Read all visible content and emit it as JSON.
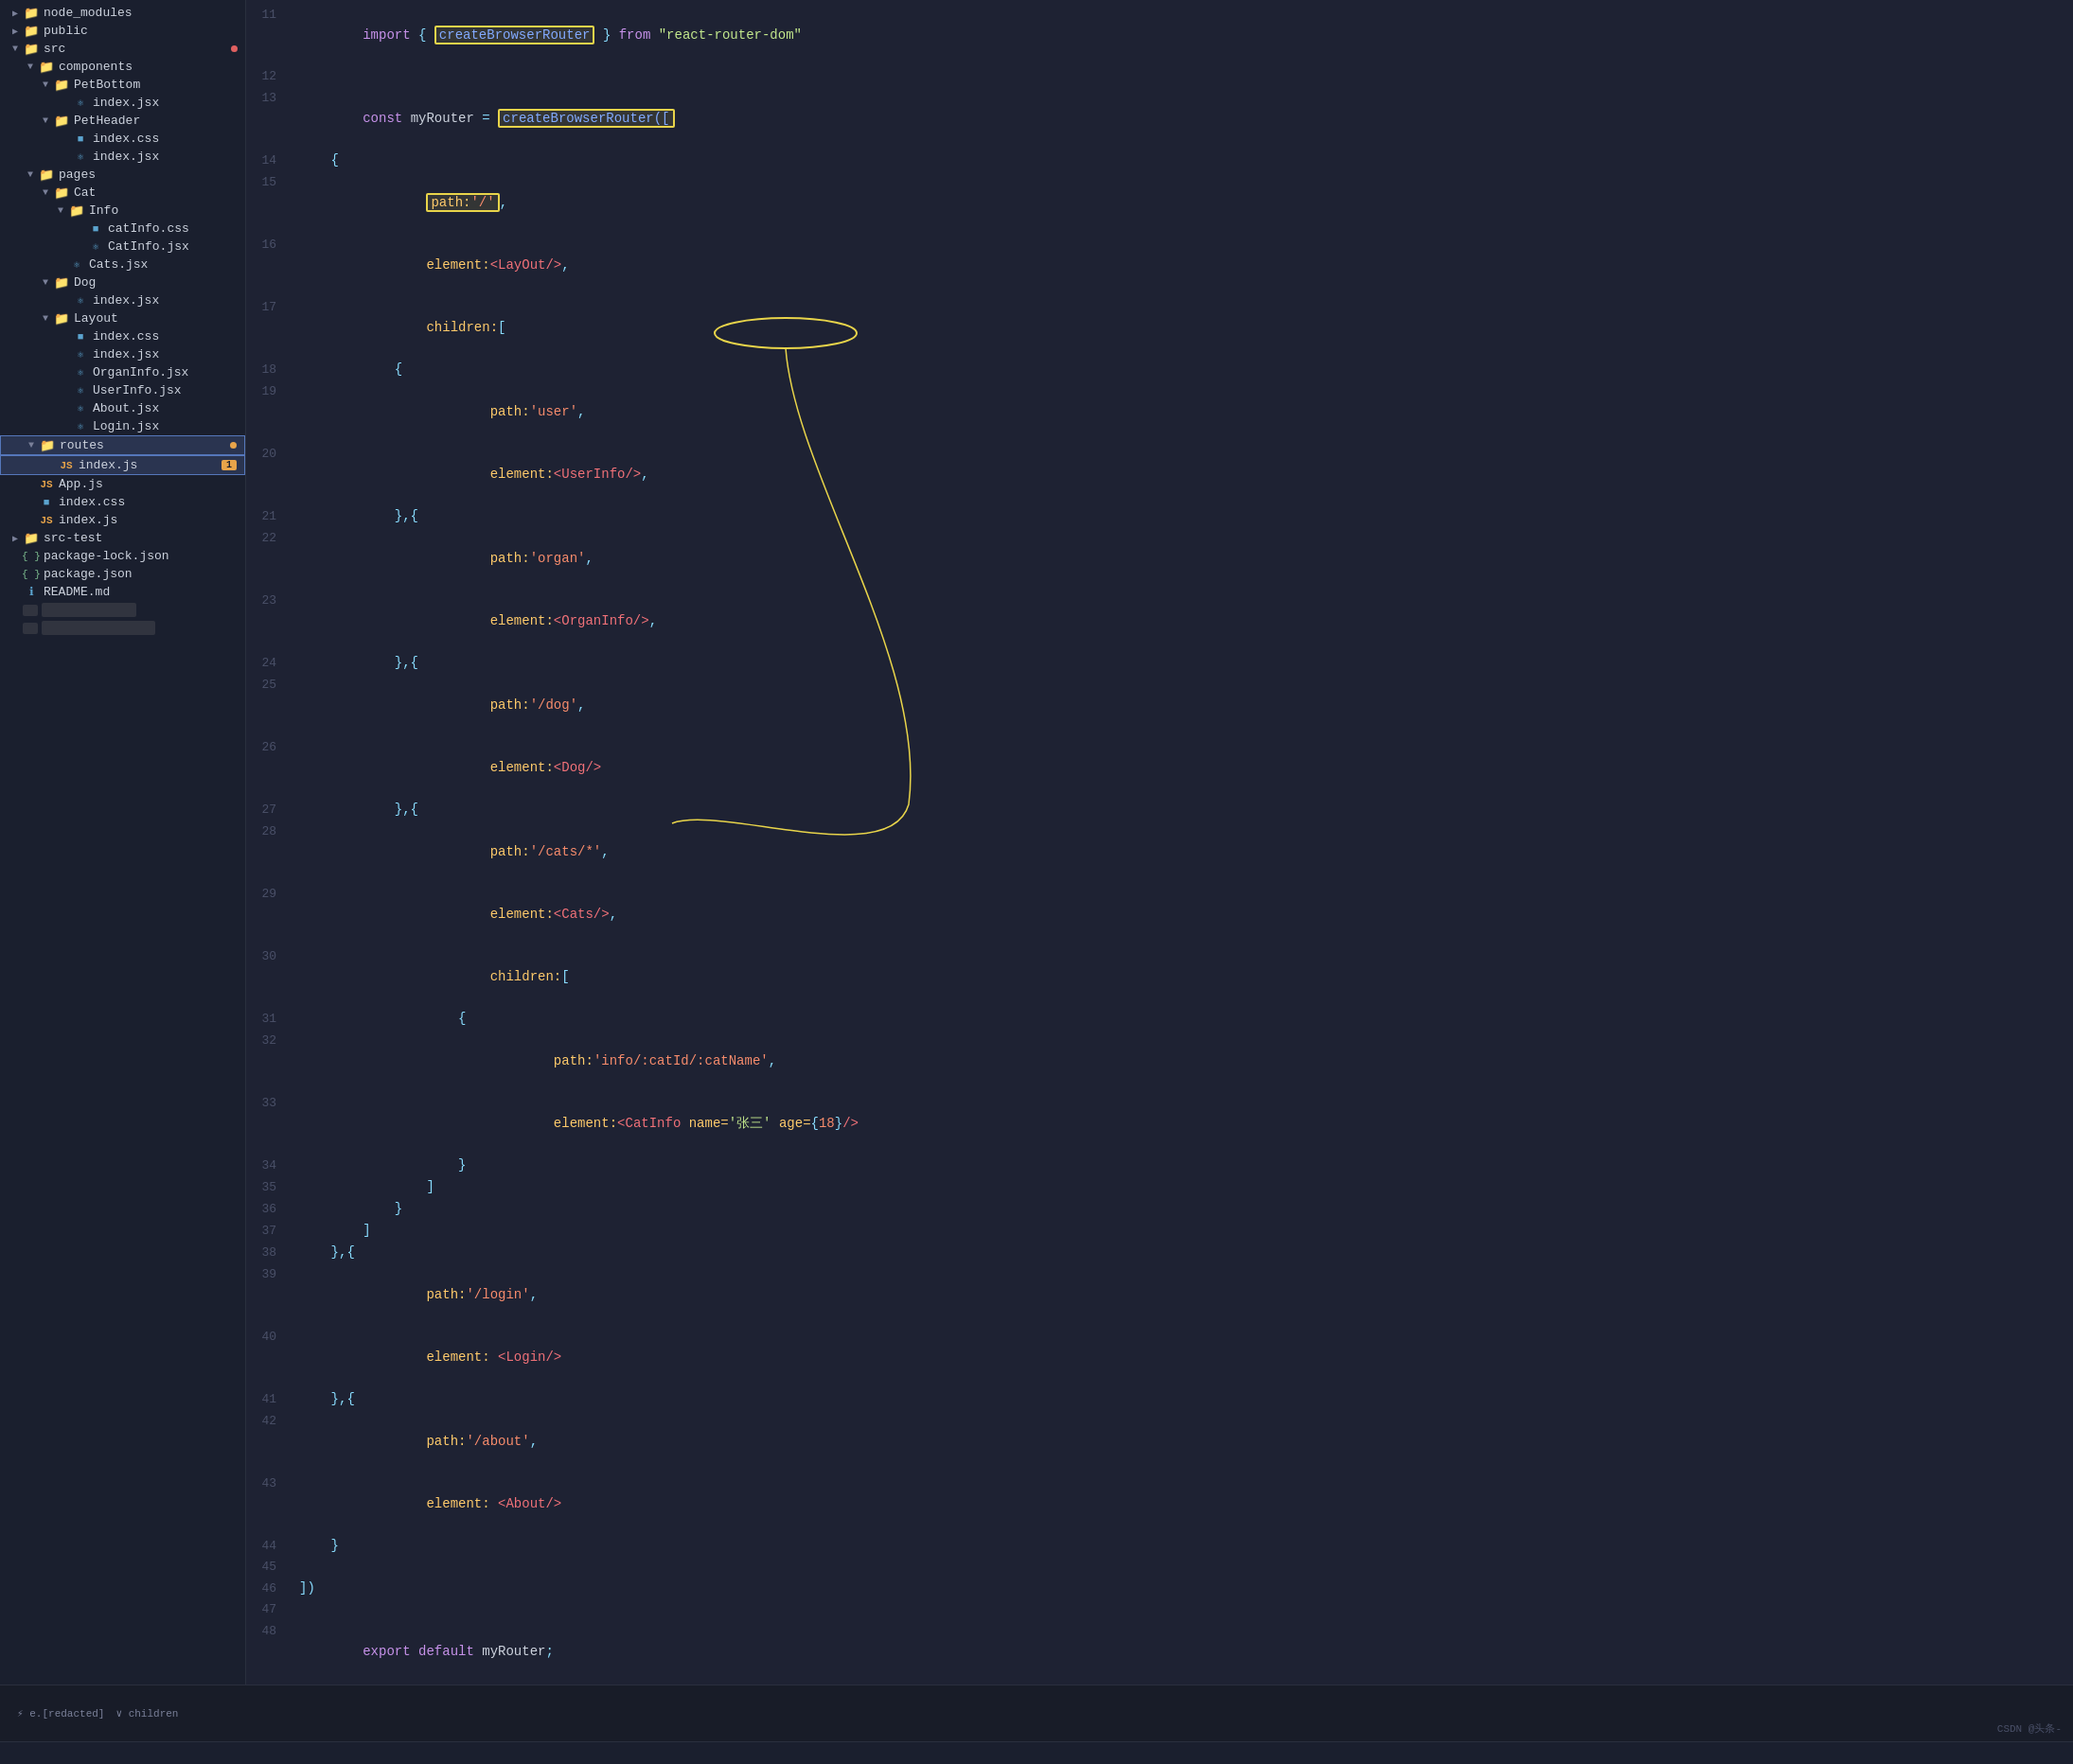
{
  "sidebar": {
    "items": [
      {
        "id": "node_modules",
        "label": "node_modules",
        "type": "folder",
        "indent": 0,
        "collapsed": true,
        "hasDot": false
      },
      {
        "id": "public",
        "label": "public",
        "type": "folder",
        "indent": 0,
        "collapsed": true,
        "hasDot": false
      },
      {
        "id": "src",
        "label": "src",
        "type": "folder",
        "indent": 0,
        "collapsed": false,
        "hasDot": true
      },
      {
        "id": "components",
        "label": "components",
        "type": "folder",
        "indent": 1,
        "collapsed": false
      },
      {
        "id": "PetBottom",
        "label": "PetBottom",
        "type": "folder",
        "indent": 2,
        "collapsed": false
      },
      {
        "id": "PetBottom_index",
        "label": "index.jsx",
        "type": "jsx",
        "indent": 3
      },
      {
        "id": "PetHeader",
        "label": "PetHeader",
        "type": "folder",
        "indent": 2,
        "collapsed": false
      },
      {
        "id": "PetHeader_css",
        "label": "index.css",
        "type": "css",
        "indent": 3
      },
      {
        "id": "PetHeader_jsx",
        "label": "index.jsx",
        "type": "jsx",
        "indent": 3
      },
      {
        "id": "pages",
        "label": "pages",
        "type": "folder",
        "indent": 1,
        "collapsed": false
      },
      {
        "id": "Cat",
        "label": "Cat",
        "type": "folder-orange",
        "indent": 2,
        "collapsed": false
      },
      {
        "id": "Info",
        "label": "Info",
        "type": "folder-orange",
        "indent": 3,
        "collapsed": false
      },
      {
        "id": "catInfo_css",
        "label": "catInfo.css",
        "type": "css",
        "indent": 4
      },
      {
        "id": "CatInfo_jsx",
        "label": "CatInfo.jsx",
        "type": "jsx",
        "indent": 4
      },
      {
        "id": "Cats_jsx",
        "label": "Cats.jsx",
        "type": "jsx",
        "indent": 3
      },
      {
        "id": "Dog",
        "label": "Dog",
        "type": "folder",
        "indent": 2,
        "collapsed": false
      },
      {
        "id": "Dog_index",
        "label": "index.jsx",
        "type": "jsx",
        "indent": 3
      },
      {
        "id": "Layout",
        "label": "Layout",
        "type": "folder",
        "indent": 2,
        "collapsed": false
      },
      {
        "id": "Layout_css",
        "label": "index.css",
        "type": "css",
        "indent": 3
      },
      {
        "id": "Layout_jsx",
        "label": "index.jsx",
        "type": "jsx",
        "indent": 3
      },
      {
        "id": "OrganInfo_jsx",
        "label": "OrganInfo.jsx",
        "type": "jsx",
        "indent": 3
      },
      {
        "id": "UserInfo_jsx",
        "label": "UserInfo.jsx",
        "type": "jsx",
        "indent": 3
      },
      {
        "id": "About_jsx",
        "label": "About.jsx",
        "type": "jsx",
        "indent": 3
      },
      {
        "id": "Login_jsx",
        "label": "Login.jsx",
        "type": "jsx",
        "indent": 3
      },
      {
        "id": "routes",
        "label": "routes",
        "type": "folder-highlighted",
        "indent": 1,
        "collapsed": false,
        "hasDot": true
      },
      {
        "id": "routes_index",
        "label": "index.js",
        "type": "js-highlighted",
        "indent": 2,
        "badge": "1"
      },
      {
        "id": "App_js",
        "label": "App.js",
        "type": "js",
        "indent": 1
      },
      {
        "id": "index_css",
        "label": "index.css",
        "type": "css",
        "indent": 1
      },
      {
        "id": "index_js2",
        "label": "index.js",
        "type": "js",
        "indent": 1
      },
      {
        "id": "src-test",
        "label": "src-test",
        "type": "folder",
        "indent": 0,
        "collapsed": true
      },
      {
        "id": "package_lock",
        "label": "package-lock.json",
        "type": "json",
        "indent": 0
      },
      {
        "id": "package_json",
        "label": "package.json",
        "type": "json",
        "indent": 0
      },
      {
        "id": "README",
        "label": "README.md",
        "type": "md-info",
        "indent": 0
      }
    ]
  },
  "editor": {
    "filename": "index.js",
    "lines": [
      {
        "num": 11,
        "tokens": [
          {
            "text": "import ",
            "cls": "kw"
          },
          {
            "text": "{ ",
            "cls": "punct"
          },
          {
            "text": "createBrowserRouter",
            "cls": "fn",
            "highlight": "box-yellow"
          },
          {
            "text": " }",
            "cls": "punct"
          },
          {
            "text": " from ",
            "cls": "kw"
          },
          {
            "text": "\"react-router-dom\"",
            "cls": "str"
          }
        ]
      },
      {
        "num": 12,
        "tokens": []
      },
      {
        "num": 13,
        "tokens": [
          {
            "text": "const ",
            "cls": "kw"
          },
          {
            "text": "myRouter ",
            "cls": "plain"
          },
          {
            "text": "= ",
            "cls": "punct"
          },
          {
            "text": "createBrowserRouter([",
            "cls": "fn",
            "highlight": "box-yellow"
          }
        ]
      },
      {
        "num": 14,
        "tokens": [
          {
            "text": "    {",
            "cls": "punct"
          }
        ]
      },
      {
        "num": 15,
        "tokens": [
          {
            "text": "        ",
            "cls": "plain"
          },
          {
            "text": "path:'/'",
            "cls": "",
            "highlight": "box-yellow",
            "inner": [
              {
                "text": "path:",
                "cls": "prop"
              },
              {
                "text": "'/'",
                "cls": "str-path"
              }
            ]
          },
          {
            "text": ",",
            "cls": "punct"
          }
        ]
      },
      {
        "num": 16,
        "tokens": [
          {
            "text": "        ",
            "cls": "plain"
          },
          {
            "text": "element:",
            "cls": "prop"
          },
          {
            "text": "<LayOut/>",
            "cls": "tag"
          },
          {
            "text": ",",
            "cls": "punct"
          }
        ]
      },
      {
        "num": 17,
        "tokens": [
          {
            "text": "        ",
            "cls": "plain"
          },
          {
            "text": "children:",
            "cls": "prop"
          },
          {
            "text": "[",
            "cls": "punct"
          }
        ]
      },
      {
        "num": 18,
        "tokens": [
          {
            "text": "            {",
            "cls": "punct"
          }
        ]
      },
      {
        "num": 19,
        "tokens": [
          {
            "text": "                ",
            "cls": "plain"
          },
          {
            "text": "path:",
            "cls": "prop"
          },
          {
            "text": "'user'",
            "cls": "str-path"
          },
          {
            "text": ",",
            "cls": "punct"
          }
        ]
      },
      {
        "num": 20,
        "tokens": [
          {
            "text": "                ",
            "cls": "plain"
          },
          {
            "text": "element:",
            "cls": "prop"
          },
          {
            "text": "<UserInfo/>",
            "cls": "tag"
          },
          {
            "text": ",",
            "cls": "punct"
          }
        ]
      },
      {
        "num": 21,
        "tokens": [
          {
            "text": "            },{",
            "cls": "punct"
          }
        ]
      },
      {
        "num": 22,
        "tokens": [
          {
            "text": "                ",
            "cls": "plain"
          },
          {
            "text": "path:",
            "cls": "prop"
          },
          {
            "text": "'organ'",
            "cls": "str-path"
          },
          {
            "text": ",",
            "cls": "punct"
          }
        ]
      },
      {
        "num": 23,
        "tokens": [
          {
            "text": "                ",
            "cls": "plain"
          },
          {
            "text": "element:",
            "cls": "prop"
          },
          {
            "text": "<OrganInfo/>",
            "cls": "tag"
          },
          {
            "text": ",",
            "cls": "punct"
          }
        ]
      },
      {
        "num": 24,
        "tokens": [
          {
            "text": "            },{",
            "cls": "punct"
          }
        ]
      },
      {
        "num": 25,
        "tokens": [
          {
            "text": "                ",
            "cls": "plain"
          },
          {
            "text": "path:",
            "cls": "prop"
          },
          {
            "text": "'/dog'",
            "cls": "str-path"
          },
          {
            "text": ",",
            "cls": "punct"
          }
        ]
      },
      {
        "num": 26,
        "tokens": [
          {
            "text": "                ",
            "cls": "plain"
          },
          {
            "text": "element:",
            "cls": "prop"
          },
          {
            "text": "<Dog/>",
            "cls": "tag"
          }
        ]
      },
      {
        "num": 27,
        "tokens": [
          {
            "text": "            },{",
            "cls": "punct"
          }
        ]
      },
      {
        "num": 28,
        "tokens": [
          {
            "text": "                ",
            "cls": "plain"
          },
          {
            "text": "path:",
            "cls": "prop"
          },
          {
            "text": "'/cats/*'",
            "cls": "str-path"
          },
          {
            "text": ",",
            "cls": "punct"
          }
        ]
      },
      {
        "num": 29,
        "tokens": [
          {
            "text": "                ",
            "cls": "plain"
          },
          {
            "text": "element:",
            "cls": "prop"
          },
          {
            "text": "<Cats/>",
            "cls": "tag"
          },
          {
            "text": ",",
            "cls": "punct"
          }
        ]
      },
      {
        "num": 30,
        "tokens": [
          {
            "text": "                ",
            "cls": "plain"
          },
          {
            "text": "children:",
            "cls": "prop"
          },
          {
            "text": "[",
            "cls": "punct"
          }
        ]
      },
      {
        "num": 31,
        "tokens": [
          {
            "text": "                    {",
            "cls": "punct"
          }
        ]
      },
      {
        "num": 32,
        "tokens": [
          {
            "text": "                        ",
            "cls": "plain"
          },
          {
            "text": "path:",
            "cls": "prop"
          },
          {
            "text": "'info/:catId/:catName'",
            "cls": "str-path"
          },
          {
            "text": ",",
            "cls": "punct"
          }
        ]
      },
      {
        "num": 33,
        "tokens": [
          {
            "text": "                        ",
            "cls": "plain"
          },
          {
            "text": "element:",
            "cls": "prop"
          },
          {
            "text": "<CatInfo ",
            "cls": "tag"
          },
          {
            "text": "name=",
            "cls": "prop"
          },
          {
            "text": "'张三' ",
            "cls": "str"
          },
          {
            "text": "age=",
            "cls": "prop"
          },
          {
            "text": "{",
            "cls": "punct"
          },
          {
            "text": "18",
            "cls": "num"
          },
          {
            "text": "}",
            "cls": "punct"
          },
          {
            "text": "/>",
            "cls": "tag"
          }
        ]
      },
      {
        "num": 34,
        "tokens": [
          {
            "text": "                    }",
            "cls": "punct"
          }
        ]
      },
      {
        "num": 35,
        "tokens": [
          {
            "text": "                ]",
            "cls": "punct"
          }
        ]
      },
      {
        "num": 36,
        "tokens": [
          {
            "text": "            }",
            "cls": "punct"
          }
        ]
      },
      {
        "num": 37,
        "tokens": [
          {
            "text": "        ]",
            "cls": "punct"
          }
        ]
      },
      {
        "num": 38,
        "tokens": [
          {
            "text": "    },{",
            "cls": "punct"
          }
        ]
      },
      {
        "num": 39,
        "tokens": [
          {
            "text": "        ",
            "cls": "plain"
          },
          {
            "text": "path:",
            "cls": "prop"
          },
          {
            "text": "'/login'",
            "cls": "str-path"
          },
          {
            "text": ",",
            "cls": "punct"
          }
        ]
      },
      {
        "num": 40,
        "tokens": [
          {
            "text": "        ",
            "cls": "plain"
          },
          {
            "text": "element: ",
            "cls": "prop"
          },
          {
            "text": "<Login/>",
            "cls": "tag"
          }
        ]
      },
      {
        "num": 41,
        "tokens": [
          {
            "text": "    },{",
            "cls": "punct"
          }
        ]
      },
      {
        "num": 42,
        "tokens": [
          {
            "text": "        ",
            "cls": "plain"
          },
          {
            "text": "path:",
            "cls": "prop"
          },
          {
            "text": "'/about'",
            "cls": "str-path"
          },
          {
            "text": ",",
            "cls": "punct"
          }
        ]
      },
      {
        "num": 43,
        "tokens": [
          {
            "text": "        ",
            "cls": "plain"
          },
          {
            "text": "element: ",
            "cls": "prop"
          },
          {
            "text": "<About/>",
            "cls": "tag"
          }
        ]
      },
      {
        "num": 44,
        "tokens": [
          {
            "text": "    }",
            "cls": "punct"
          }
        ]
      },
      {
        "num": 45,
        "tokens": []
      },
      {
        "num": 46,
        "tokens": [
          {
            "text": "])",
            "cls": "punct"
          }
        ]
      },
      {
        "num": 47,
        "tokens": []
      },
      {
        "num": 48,
        "tokens": [
          {
            "text": "export ",
            "cls": "kw"
          },
          {
            "text": "default ",
            "cls": "kw"
          },
          {
            "text": "myRouter",
            "cls": "plain"
          },
          {
            "text": ";",
            "cls": "punct"
          }
        ]
      }
    ]
  },
  "statusbar": {
    "left": "⚡ e. [redacted]",
    "right": "CSDN @头条-"
  },
  "watermark": "CSDN @头条-",
  "bottom_panel": {
    "items": [
      {
        "label": "elem..."
      },
      {
        "label": "children"
      }
    ]
  }
}
